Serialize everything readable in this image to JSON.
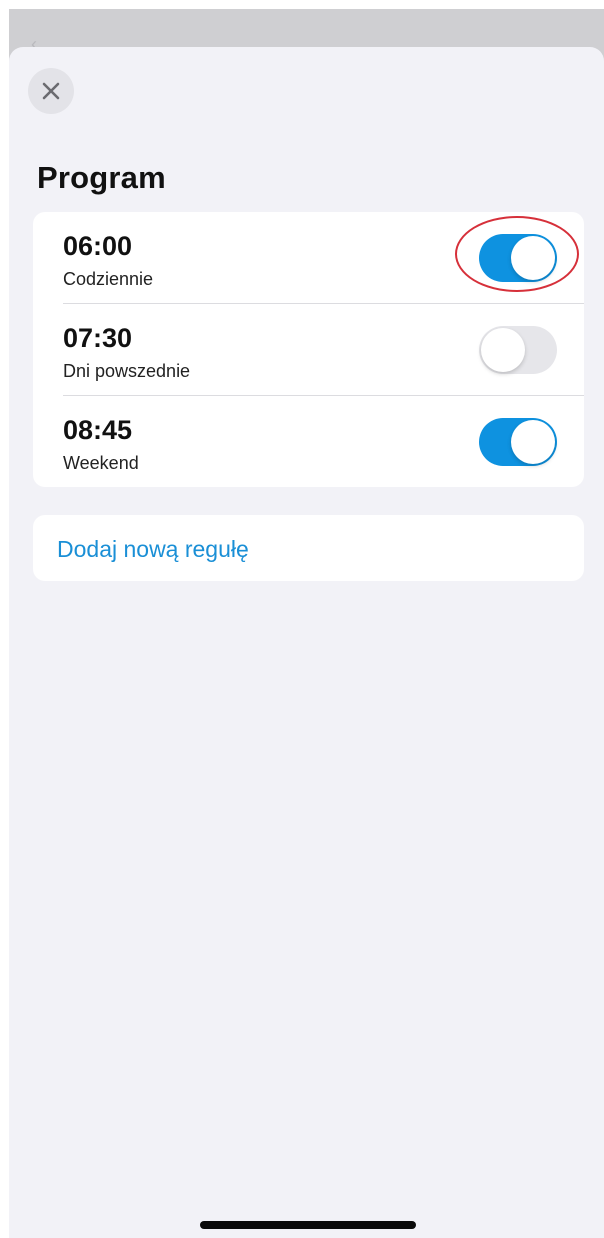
{
  "screen": {
    "title": "Program",
    "close_icon": "close-icon"
  },
  "rules": [
    {
      "time": "06:00",
      "days": "Codziennie",
      "enabled": true
    },
    {
      "time": "07:30",
      "days": "Dni powszednie",
      "enabled": false
    },
    {
      "time": "08:45",
      "days": "Weekend",
      "enabled": true
    }
  ],
  "add_rule": {
    "label": "Dodaj nową regułę"
  },
  "colors": {
    "accent": "#0e92e0",
    "link": "#1a8fd6",
    "toggle_off": "#e6e6ea",
    "highlight": "#d6303a",
    "background": "#f2f2f7"
  }
}
